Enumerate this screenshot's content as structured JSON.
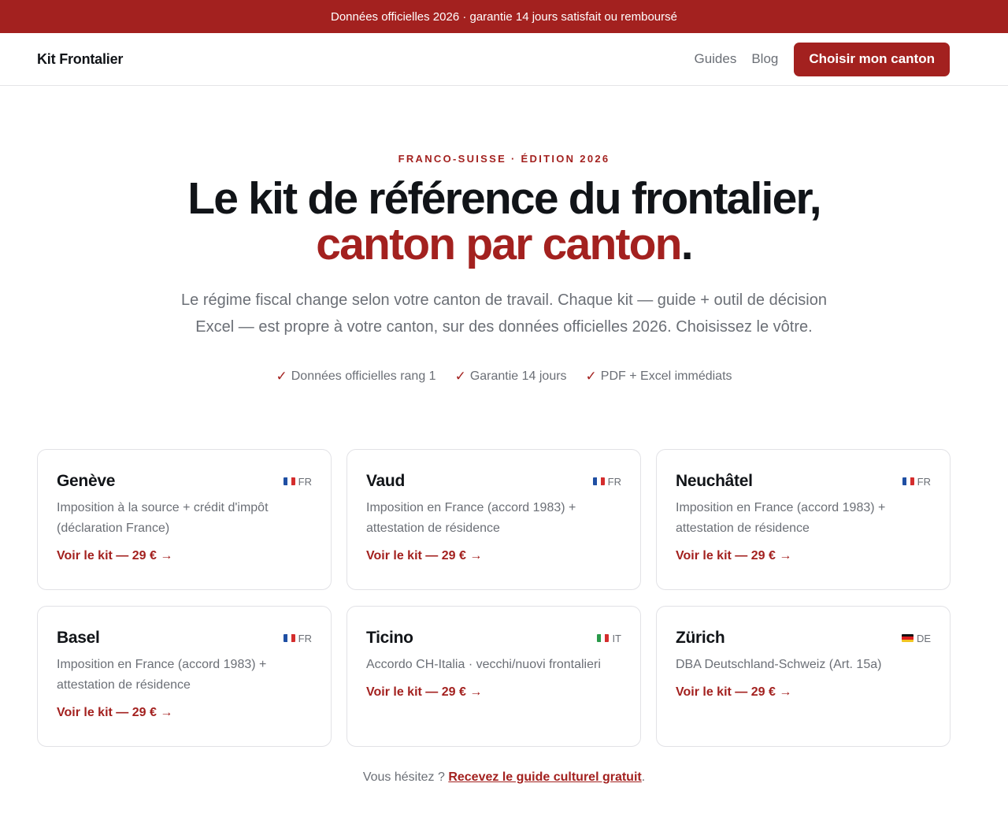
{
  "announcement": "Données officielles 2026 · garantie 14 jours satisfait ou remboursé",
  "nav": {
    "brand": "Kit Frontalier",
    "links": [
      "Guides",
      "Blog"
    ],
    "cta": "Choisir mon canton"
  },
  "hero": {
    "eyebrow": "FRANCO-SUISSE · ÉDITION 2026",
    "title_line1": "Le kit de référence du frontalier,",
    "title_accent": "canton par canton",
    "title_end": ".",
    "lead": "Le régime fiscal change selon votre canton de travail. Chaque kit — guide + outil de décision Excel — est propre à votre canton, sur des données officielles 2026. Choisissez le vôtre.",
    "checks": [
      "Données officielles rang 1",
      "Garantie 14 jours",
      "PDF + Excel immédiats"
    ]
  },
  "cards": [
    {
      "name": "Genève",
      "lang": "FR",
      "desc": "Imposition à la source + crédit d'impôt (déclaration France)",
      "link": "Voir le kit — 29 € →"
    },
    {
      "name": "Vaud",
      "lang": "FR",
      "desc": "Imposition en France (accord 1983) + attestation de résidence",
      "link": "Voir le kit — 29 € →"
    },
    {
      "name": "Neuchâtel",
      "lang": "FR",
      "desc": "Imposition en France (accord 1983) + attestation de résidence",
      "link": "Voir le kit — 29 € →"
    },
    {
      "name": "Basel",
      "lang": "FR",
      "desc": "Imposition en France (accord 1983) + attestation de résidence",
      "link": "Voir le kit — 29 € →"
    },
    {
      "name": "Ticino",
      "lang": "IT",
      "desc": "Accordo CH-Italia · vecchi/nuovi frontalieri",
      "link": "Voir le kit — 29 € →"
    },
    {
      "name": "Zürich",
      "lang": "DE",
      "desc": "DBA Deutschland-Schweiz (Art. 15a)",
      "link": "Voir le kit — 29 € →"
    }
  ],
  "footer": {
    "prefix": "Vous hésitez ? ",
    "link": "Recevez le guide culturel gratuit",
    "suffix": "."
  },
  "colors": {
    "accent": "#a3211f",
    "muted": "#6b6f76",
    "text": "#111418"
  },
  "icons": {
    "check": "check-icon",
    "flag_fr": "flag-fr-icon",
    "flag_it": "flag-it-icon",
    "flag_de": "flag-de-icon"
  }
}
